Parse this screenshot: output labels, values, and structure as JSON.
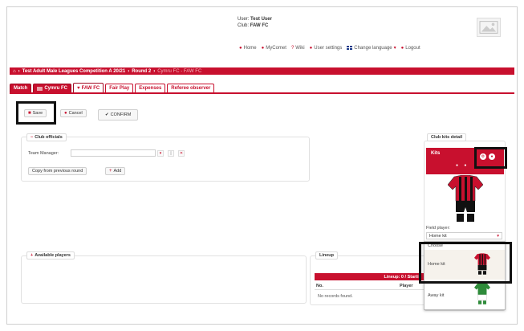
{
  "header": {
    "user_label": "User:",
    "user_name": "Test User",
    "club_label": "Club:",
    "club_name": "FAW FC",
    "nav": [
      {
        "label": "Home",
        "icon": "home-icon"
      },
      {
        "label": "MyComet",
        "icon": "person-icon"
      },
      {
        "label": "Wiki",
        "icon": "question-icon"
      },
      {
        "label": "User settings",
        "icon": "user-settings-icon"
      },
      {
        "label": "Change language",
        "icon": "gb-flag-icon"
      },
      {
        "label": "Logout",
        "icon": "logout-icon"
      }
    ]
  },
  "breadcrumb": {
    "competition": "Test Adult Male Leagues Competition A 20/21",
    "round": "Round 2",
    "match": "Cymru FC - FAW FC"
  },
  "tabs": [
    {
      "label": "Match"
    },
    {
      "label": "Cymru FC"
    },
    {
      "label": "FAW FC"
    },
    {
      "label": "Fair Play"
    },
    {
      "label": "Expenses"
    },
    {
      "label": "Referee observer"
    }
  ],
  "actions": {
    "save": "Save",
    "cancel": "Cancel",
    "confirm": "CONFIRM"
  },
  "officials": {
    "title": "Club officials",
    "team_manager_label": "Team Manager:",
    "copy_button": "Copy from previous round",
    "add_button": "Add"
  },
  "available_players": {
    "title": "Available players"
  },
  "lineup": {
    "title": "Lineup",
    "bar_label": "Lineup: 0 / Startin",
    "col_no": "No.",
    "col_player": "Player",
    "empty": "No records found."
  },
  "kits": {
    "title": "Club kits detail",
    "kits_label": "Kits",
    "field_player_label": "Field player:",
    "field_player_value": "Home kit",
    "options": [
      "Choose",
      "Home kit",
      "Away kit"
    ],
    "shirt_color": "#c8102e",
    "away_color": "#2e8b3a"
  },
  "colors": {
    "accent": "#c8102e"
  }
}
